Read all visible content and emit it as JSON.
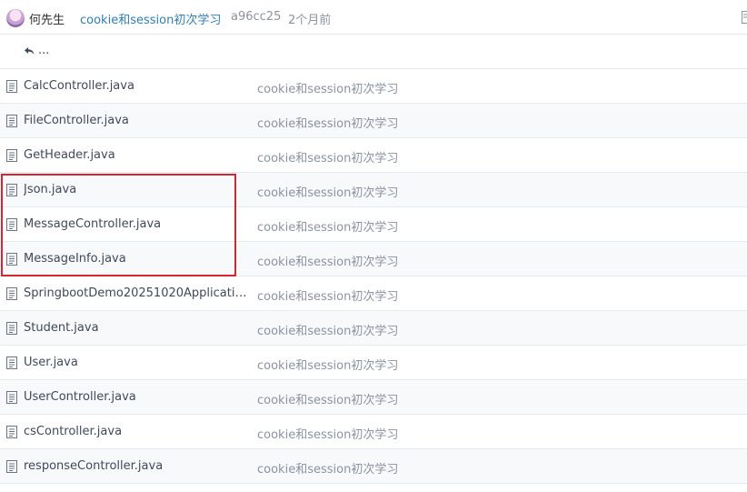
{
  "commit": {
    "author": "何先生",
    "message": "cookie和session初次学习",
    "hash": "a96cc25",
    "time": "2个月前"
  },
  "back_label": "...",
  "files": [
    {
      "name": "CalcController.java",
      "message": "cookie和session初次学习"
    },
    {
      "name": "FileController.java",
      "message": "cookie和session初次学习"
    },
    {
      "name": "GetHeader.java",
      "message": "cookie和session初次学习"
    },
    {
      "name": "Json.java",
      "message": "cookie和session初次学习"
    },
    {
      "name": "MessageController.java",
      "message": "cookie和session初次学习"
    },
    {
      "name": "MessageInfo.java",
      "message": "cookie和session初次学习"
    },
    {
      "name": "SpringbootDemo20251020Application....",
      "message": "cookie和session初次学习"
    },
    {
      "name": "Student.java",
      "message": "cookie和session初次学习"
    },
    {
      "name": "User.java",
      "message": "cookie和session初次学习"
    },
    {
      "name": "UserController.java",
      "message": "cookie和session初次学习"
    },
    {
      "name": "csController.java",
      "message": "cookie和session初次学习"
    },
    {
      "name": "responseController.java",
      "message": "cookie和session初次学习"
    }
  ],
  "colors": {
    "link": "#2f7fb6",
    "muted": "#8c92a4",
    "border": "#e3e9ed",
    "highlight": "#d9252f"
  }
}
